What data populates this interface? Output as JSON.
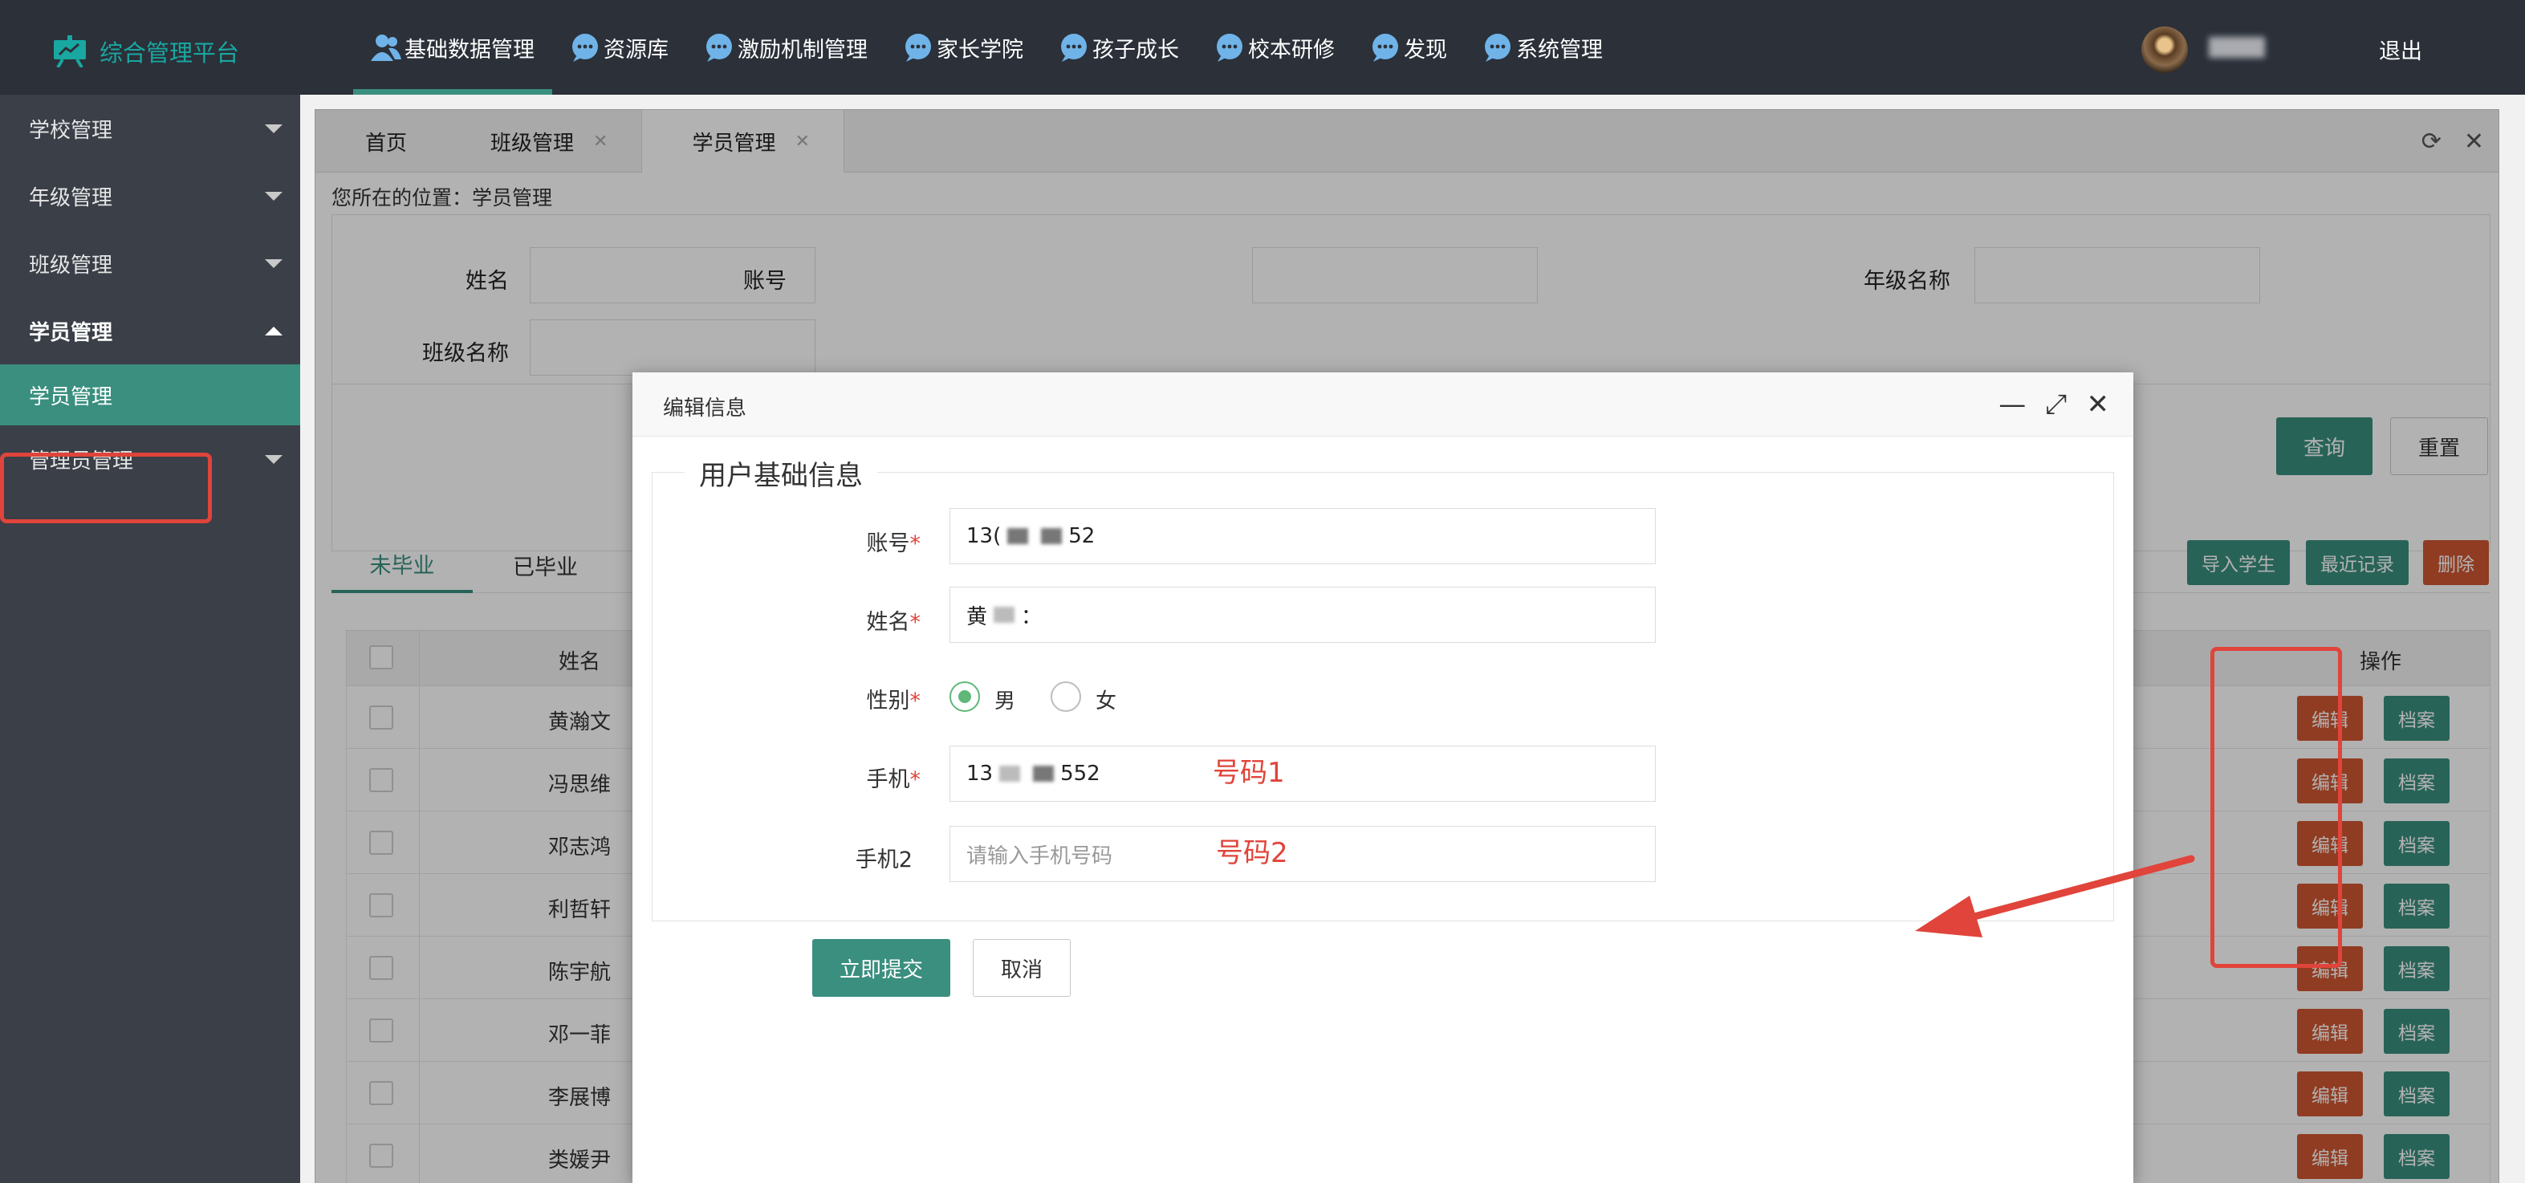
{
  "app": {
    "title": "综合管理平台"
  },
  "nav": [
    {
      "label": "基础数据管理",
      "icon": "users-icon",
      "active": true
    },
    {
      "label": "资源库",
      "icon": "chat-bubble-icon"
    },
    {
      "label": "激励机制管理",
      "icon": "chat-bubble-icon"
    },
    {
      "label": "家长学院",
      "icon": "chat-bubble-icon"
    },
    {
      "label": "孩子成长",
      "icon": "chat-bubble-icon"
    },
    {
      "label": "校本研修",
      "icon": "chat-bubble-icon"
    },
    {
      "label": "发现",
      "icon": "chat-bubble-icon"
    },
    {
      "label": "系统管理",
      "icon": "chat-bubble-icon"
    }
  ],
  "user": {
    "logout": "退出"
  },
  "sidebar": {
    "items": [
      {
        "label": "学校管理"
      },
      {
        "label": "年级管理"
      },
      {
        "label": "班级管理"
      },
      {
        "label": "学员管理",
        "open": true
      },
      {
        "label": "学员管理",
        "sub": true,
        "active": true
      },
      {
        "label": "管理员管理"
      }
    ]
  },
  "tabs": [
    {
      "label": "首页"
    },
    {
      "label": "班级管理",
      "closable": true
    },
    {
      "label": "学员管理",
      "closable": true,
      "active": true
    }
  ],
  "breadcrumb": "您所在的位置：学员管理",
  "search": {
    "name_label": "姓名",
    "account_label": "账号",
    "grade_label": "年级名称",
    "class_label": "班级名称",
    "query_button": "查询",
    "reset_button": "重置"
  },
  "status_tabs": [
    "未毕业",
    "已毕业"
  ],
  "actions": {
    "import": "导入学生",
    "recent": "最近记录",
    "delete": "删除"
  },
  "table": {
    "col_name": "姓名",
    "col_ops": "操作",
    "rows": [
      "黄瀚文",
      "冯思维",
      "邓志鸿",
      "利哲轩",
      "陈宇航",
      "邓一菲",
      "李展博",
      "类媛尹"
    ],
    "edit_label": "编辑",
    "file_label": "档案"
  },
  "modal": {
    "title": "编辑信息",
    "legend": "用户基础信息",
    "account_label": "账号",
    "account_value_start": "13(",
    "account_value_end": "52",
    "name_label": "姓名",
    "name_value_start": "黄",
    "name_value_end": "：",
    "gender_label": "性别",
    "gender_male": "男",
    "gender_female": "女",
    "gender_selected": "男",
    "phone_label": "手机",
    "phone_value_start": "13",
    "phone_value_end": "552",
    "phone2_label": "手机2",
    "phone2_placeholder": "请输入手机号码",
    "submit": "立即提交",
    "cancel": "取消"
  },
  "annotations": {
    "phone1": "号码1",
    "phone2": "号码2"
  },
  "colors": {
    "accent": "#3a8f7f",
    "danger": "#cf5732",
    "highlight": "#e0443a",
    "nav_bg": "#2b3039",
    "sidebar_bg": "#3a3f48"
  }
}
